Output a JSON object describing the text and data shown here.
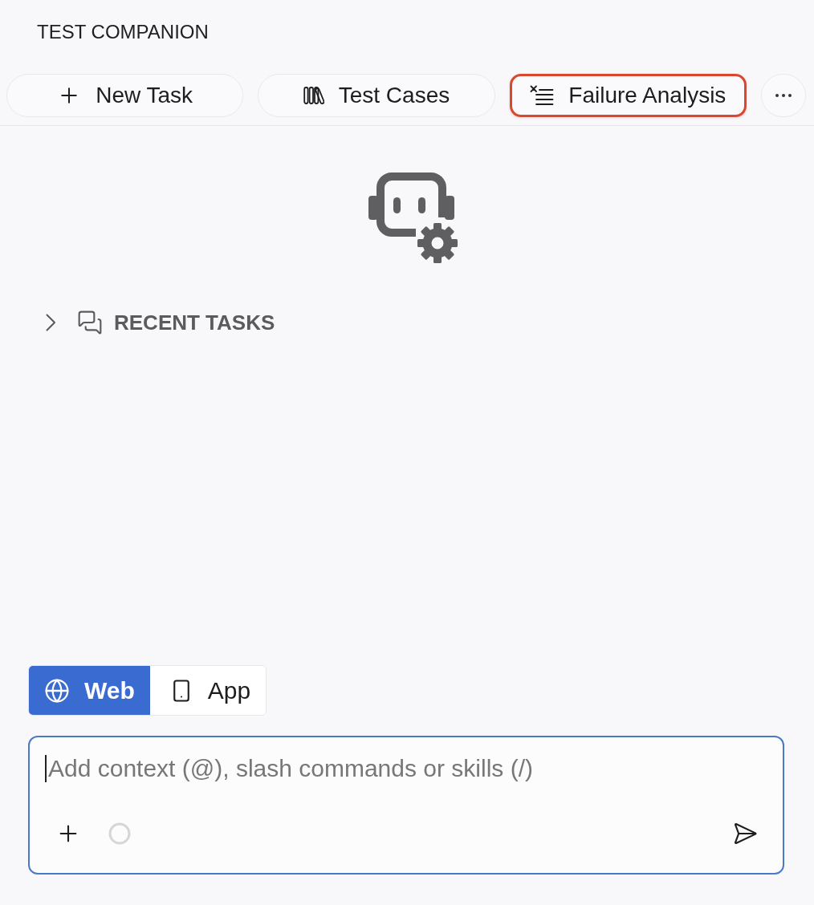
{
  "header": {
    "title": "TEST COMPANION"
  },
  "toolbar": {
    "buttons": [
      {
        "label": "New Task",
        "kind": "new",
        "highlighted": false
      },
      {
        "label": "Test Cases",
        "kind": "cases",
        "highlighted": false
      },
      {
        "label": "Failure Analysis",
        "kind": "failure",
        "highlighted": true
      }
    ]
  },
  "recent_tasks": {
    "label": "RECENT TASKS",
    "expanded": false
  },
  "mode_switch": {
    "options": [
      {
        "label": "Web",
        "kind": "web",
        "selected": true
      },
      {
        "label": "App",
        "kind": "app",
        "selected": false
      }
    ]
  },
  "composer": {
    "placeholder": "Add context (@), slash commands or skills (/)"
  }
}
